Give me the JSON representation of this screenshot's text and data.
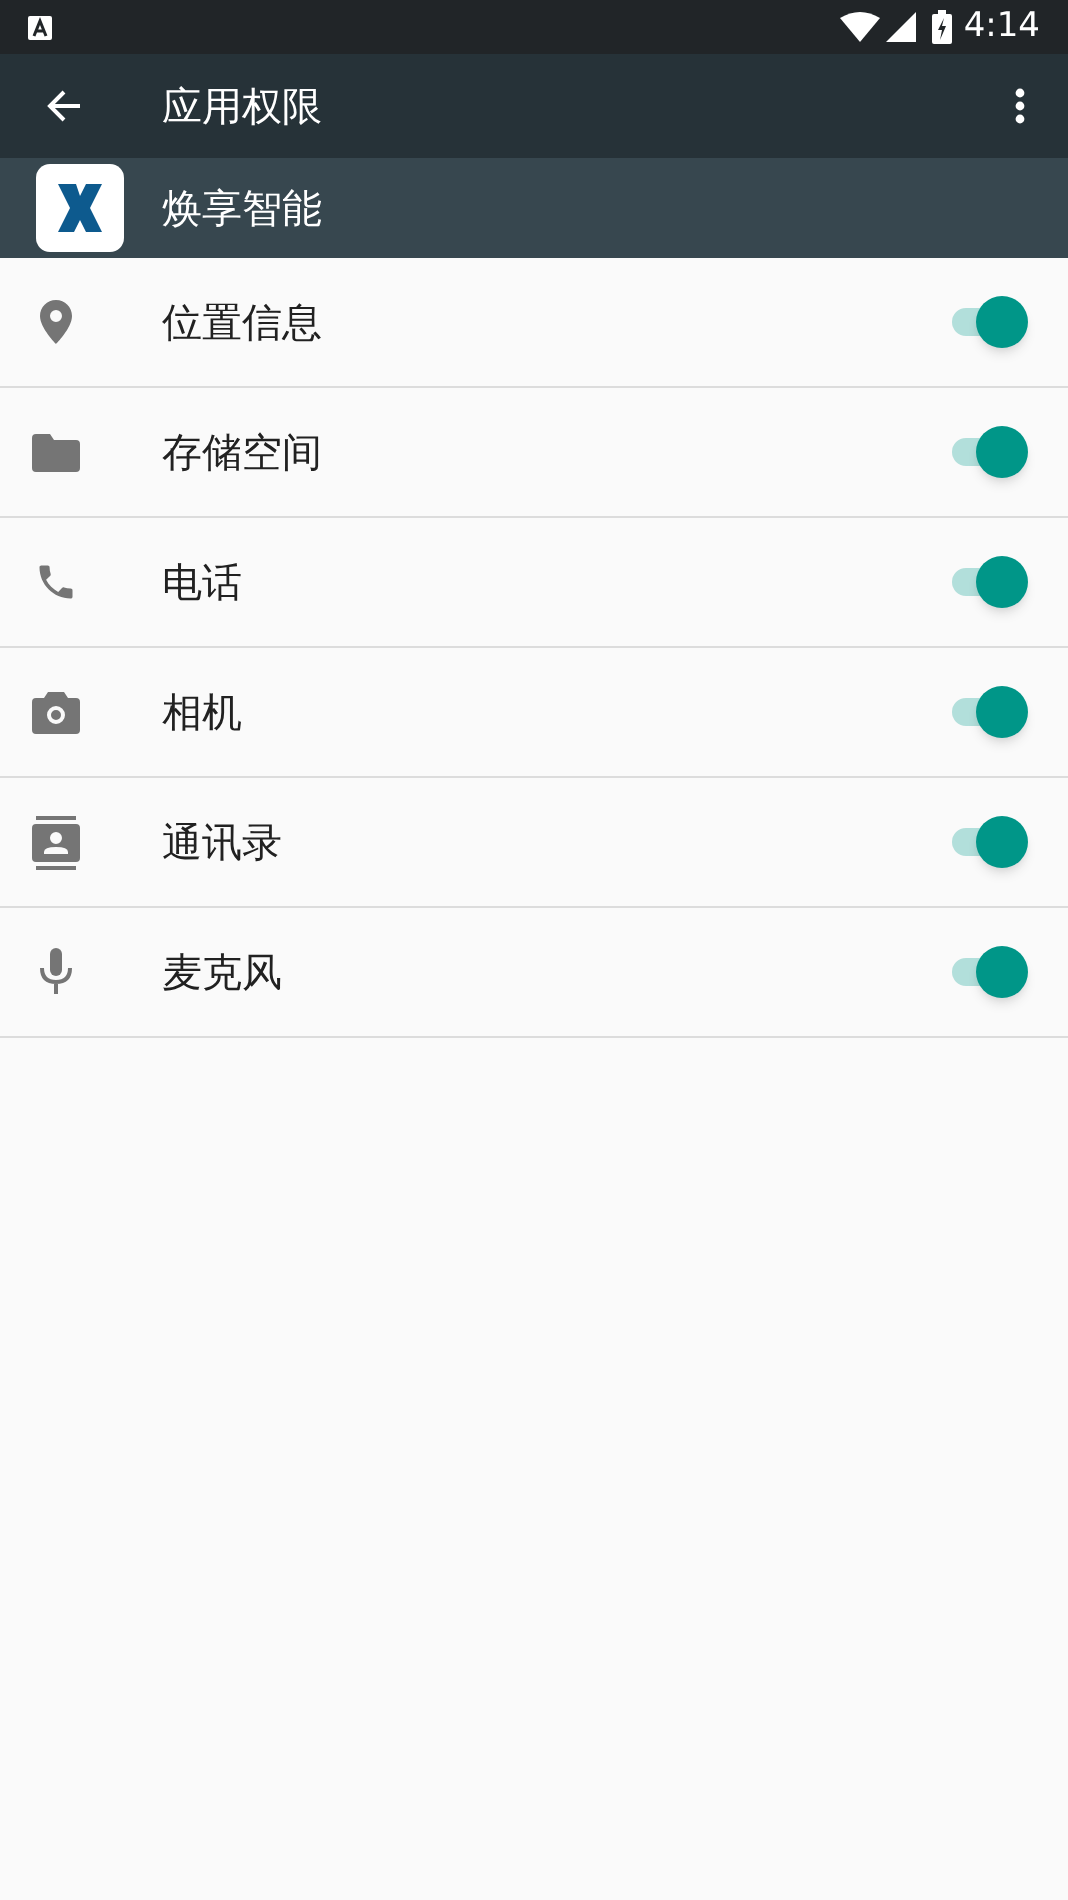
{
  "status_bar": {
    "time": "4:14"
  },
  "toolbar": {
    "title": "应用权限"
  },
  "app": {
    "name": "焕享智能"
  },
  "permissions": [
    {
      "kind": "location",
      "label": "位置信息",
      "checked": true
    },
    {
      "kind": "storage",
      "label": "存储空间",
      "checked": true
    },
    {
      "kind": "phone",
      "label": "电话",
      "checked": true
    },
    {
      "kind": "camera",
      "label": "相机",
      "checked": true
    },
    {
      "kind": "contacts",
      "label": "通讯录",
      "checked": true
    },
    {
      "kind": "microphone",
      "label": "麦克风",
      "checked": true
    }
  ]
}
